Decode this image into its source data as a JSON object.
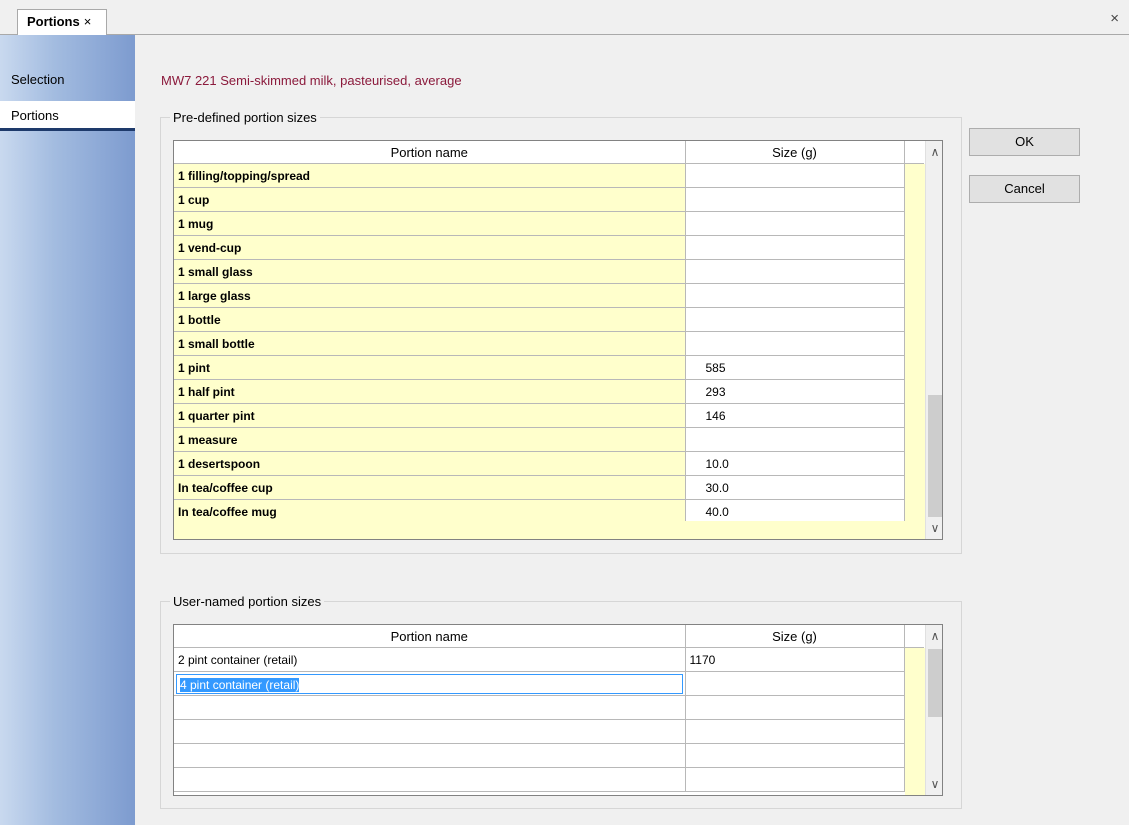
{
  "tab": {
    "title": "Portions",
    "close": "×"
  },
  "window_close": "×",
  "sidebar": {
    "items": [
      {
        "label": "Selection"
      },
      {
        "label": "Portions"
      }
    ]
  },
  "food_title": "MW7 221  Semi-skimmed milk, pasteurised, average",
  "predefined": {
    "legend": "Pre-defined portion sizes",
    "columns": [
      "Portion name",
      "Size (g)"
    ],
    "rows": [
      [
        "1 filling/topping/spread",
        ""
      ],
      [
        "1 cup",
        ""
      ],
      [
        "1 mug",
        ""
      ],
      [
        "1 vend-cup",
        ""
      ],
      [
        "1 small glass",
        ""
      ],
      [
        "1 large glass",
        ""
      ],
      [
        "1 bottle",
        ""
      ],
      [
        "1 small bottle",
        ""
      ],
      [
        "1 pint",
        "585"
      ],
      [
        "1 half pint",
        "293"
      ],
      [
        "1 quarter pint",
        "146"
      ],
      [
        "1 measure",
        ""
      ],
      [
        "1 desertspoon",
        "10.0"
      ],
      [
        "In tea/coffee cup",
        "30.0"
      ],
      [
        "In tea/coffee mug",
        "40.0"
      ]
    ]
  },
  "user": {
    "legend": "User-named portion sizes",
    "columns": [
      "Portion name",
      "Size (g)"
    ],
    "rows": [
      [
        "2 pint container (retail)",
        "1170"
      ],
      [
        "4 pint container (retail)",
        ""
      ],
      [
        "",
        ""
      ],
      [
        "",
        ""
      ],
      [
        "",
        ""
      ],
      [
        "",
        ""
      ]
    ]
  },
  "buttons": {
    "ok": "OK",
    "cancel": "Cancel"
  },
  "scroll_icons": {
    "up": "∧",
    "down": "∨"
  }
}
